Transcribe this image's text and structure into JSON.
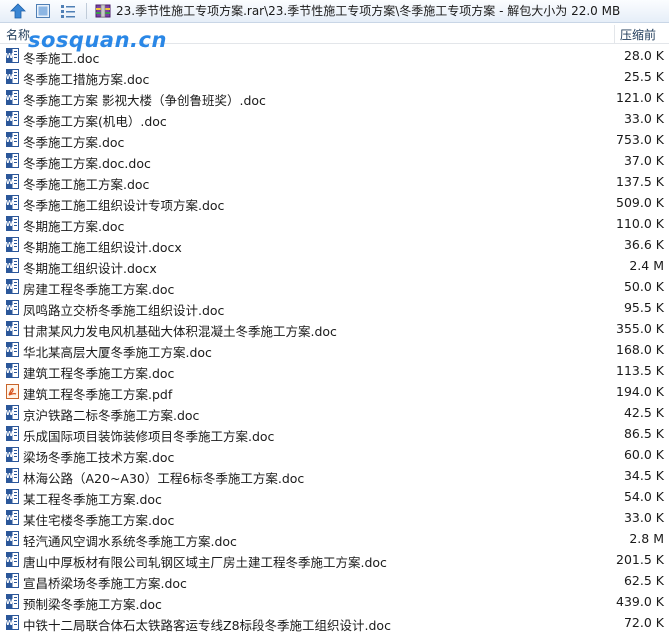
{
  "path": "23.季节性施工专项方案.rar\\23.季节性施工专项方案\\冬季施工专项方案 - 解包大小为 22.0 MB",
  "columns": {
    "name": "名称",
    "size": "压缩前"
  },
  "watermark": "sosquan.cn",
  "files": [
    {
      "name": "冬季施工.doc",
      "size": "28.0 K",
      "type": "doc-icon"
    },
    {
      "name": "冬季施工措施方案.doc",
      "size": "25.5 K",
      "type": "doc-icon"
    },
    {
      "name": "冬季施工方案 影视大楼（争创鲁班奖）.doc",
      "size": "121.0 K",
      "type": "doc-icon"
    },
    {
      "name": "冬季施工方案(机电）.doc",
      "size": "33.0 K",
      "type": "doc-icon"
    },
    {
      "name": "冬季施工方案.doc",
      "size": "753.0 K",
      "type": "doc-icon"
    },
    {
      "name": "冬季施工方案.doc.doc",
      "size": "37.0 K",
      "type": "doc-icon"
    },
    {
      "name": "冬季施工施工方案.doc",
      "size": "137.5 K",
      "type": "doc-icon"
    },
    {
      "name": "冬季施工施工组织设计专项方案.doc",
      "size": "509.0 K",
      "type": "doc-icon"
    },
    {
      "name": "冬期施工方案.doc",
      "size": "110.0 K",
      "type": "doc-icon"
    },
    {
      "name": "冬期施工施工组织设计.docx",
      "size": "36.6 K",
      "type": "doc-icon"
    },
    {
      "name": "冬期施工组织设计.docx",
      "size": "2.4 M",
      "type": "doc-icon"
    },
    {
      "name": "房建工程冬季施工方案.doc",
      "size": "50.0 K",
      "type": "doc-icon"
    },
    {
      "name": "凤鸣路立交桥冬季施工组织设计.doc",
      "size": "95.5 K",
      "type": "doc-icon"
    },
    {
      "name": "甘肃某风力发电风机基础大体积混凝土冬季施工方案.doc",
      "size": "355.0 K",
      "type": "doc-icon"
    },
    {
      "name": "华北某高层大厦冬季施工方案.doc",
      "size": "168.0 K",
      "type": "doc-icon"
    },
    {
      "name": "建筑工程冬季施工方案.doc",
      "size": "113.5 K",
      "type": "doc-icon"
    },
    {
      "name": "建筑工程冬季施工方案.pdf",
      "size": "194.0 K",
      "type": "pdf-icon"
    },
    {
      "name": "京沪铁路二标冬季施工方案.doc",
      "size": "42.5 K",
      "type": "doc-icon"
    },
    {
      "name": "乐成国际项目装饰装修项目冬季施工方案.doc",
      "size": "86.5 K",
      "type": "doc-icon"
    },
    {
      "name": "梁场冬季施工技术方案.doc",
      "size": "60.0 K",
      "type": "doc-icon"
    },
    {
      "name": "林海公路（A20~A30）工程6标冬季施工方案.doc",
      "size": "34.5 K",
      "type": "doc-icon"
    },
    {
      "name": "某工程冬季施工方案.doc",
      "size": "54.0 K",
      "type": "doc-icon"
    },
    {
      "name": "某住宅楼冬季施工方案.doc",
      "size": "33.0 K",
      "type": "doc-icon"
    },
    {
      "name": "轻汽通风空调水系统冬季施工方案.doc",
      "size": "2.8 M",
      "type": "doc-icon"
    },
    {
      "name": "唐山中厚板材有限公司轧钢区域主厂房土建工程冬季施工方案.doc",
      "size": "201.5 K",
      "type": "doc-icon"
    },
    {
      "name": "宣昌桥梁场冬季施工方案.doc",
      "size": "62.5 K",
      "type": "doc-icon"
    },
    {
      "name": "预制梁冬季施工方案.doc",
      "size": "439.0 K",
      "type": "doc-icon"
    },
    {
      "name": "中铁十二局联合体石太铁路客运专线Z8标段冬季施工组织设计.doc",
      "size": "72.0 K",
      "type": "doc-icon"
    }
  ]
}
